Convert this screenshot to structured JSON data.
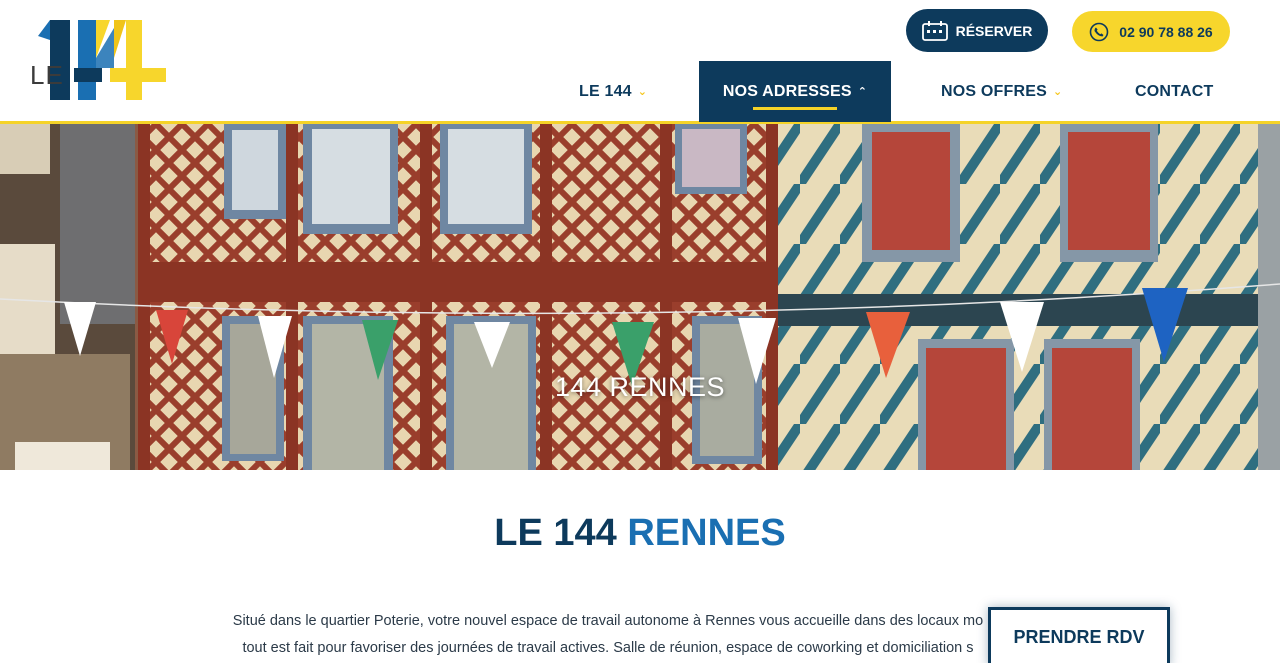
{
  "brand": {
    "logo_le": "LE",
    "logo_number": "144"
  },
  "header": {
    "reserve_label": "RÉSERVER",
    "phone_label": "02 90 78 88 26"
  },
  "nav": {
    "items": [
      {
        "label": "LE 144",
        "has_dropdown": true
      },
      {
        "label": "NOS ADRESSES",
        "has_dropdown": true,
        "active": true
      },
      {
        "label": "NOS OFFRES",
        "has_dropdown": true
      },
      {
        "label": "CONTACT",
        "has_dropdown": false
      }
    ]
  },
  "hero": {
    "title": "144 RENNES"
  },
  "main": {
    "title_prefix": "LE 144 ",
    "title_accent": "RENNES",
    "paragraph_line1": "Situé dans le quartier Poterie, votre nouvel espace de travail autonome à Rennes vous accueille dans des locaux mo",
    "paragraph_line2": "tout est fait pour favoriser des journées de travail actives. Salle de réunion, espace de coworking et domiciliation s"
  },
  "cta": {
    "rdv_label": "PRENDRE RDV"
  },
  "colors": {
    "navy": "#0d3a5c",
    "yellow": "#f7d62c",
    "blue_accent": "#1a6fb2"
  }
}
